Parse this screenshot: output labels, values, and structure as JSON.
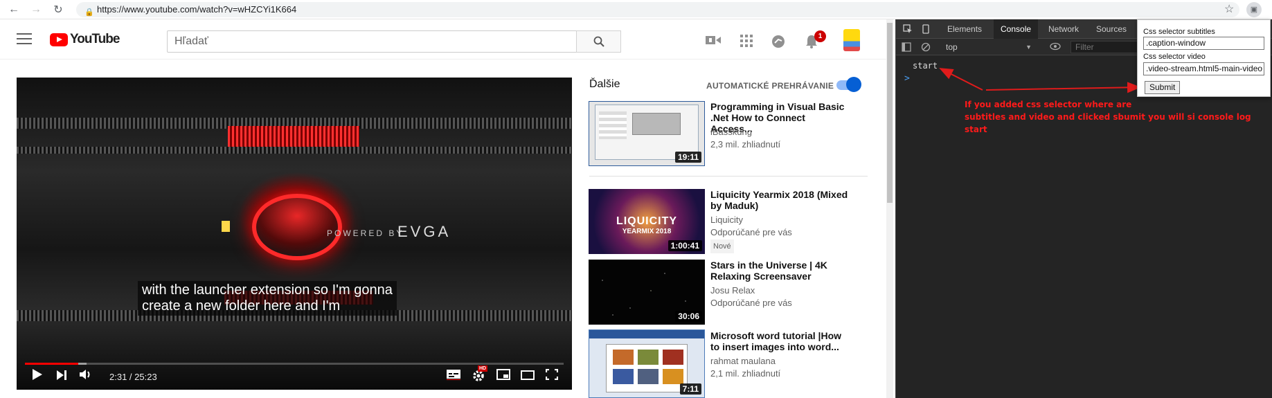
{
  "browser": {
    "url": "https://www.youtube.com/watch?v=wHZCYi1K664",
    "icons": [
      "back-icon",
      "forward-icon",
      "reload-icon",
      "lock-icon",
      "star-icon",
      "extension-icon"
    ]
  },
  "youtube": {
    "logo_text": "YouTube",
    "search_placeholder": "Hľadať",
    "notification_count": "1",
    "player": {
      "subtitle_line1": "with the launcher extension so I'm gonna",
      "subtitle_line2": "create a new folder here and I'm",
      "time": "2:31 / 25:23",
      "progress_played": 0.099,
      "progress_loaded": 0.115,
      "overlay_text": "POWERED BY",
      "overlay_brand": "EVGA",
      "hd_badge": "HD"
    },
    "sidebar": {
      "up_next": "Ďalšie",
      "autoplay_label": "AUTOMATICKÉ PREHRÁVANIE",
      "autoplay_on": true,
      "videos": [
        {
          "title": "Programming in Visual Basic .Net How to Connect Access...",
          "channel": "iBasskung",
          "meta": "2,3 mil. zhliadnutí",
          "duration": "19:11",
          "badge": ""
        },
        {
          "title": "Liquicity Yearmix 2018 (Mixed by Maduk)",
          "channel": "Liquicity",
          "meta": "Odporúčané pre vás",
          "duration": "1:00:41",
          "badge": "Nové"
        },
        {
          "title": "Stars in the Universe | 4K Relaxing Screensaver",
          "channel": "Josu Relax",
          "meta": "Odporúčané pre vás",
          "duration": "30:06",
          "badge": ""
        },
        {
          "title": "Microsoft word tutorial |How to insert images into word...",
          "channel": "rahmat maulana",
          "meta": "2,1 mil. zhliadnutí",
          "duration": "7:11",
          "badge": ""
        }
      ],
      "thumb_texts": {
        "liquicity": "LIQUICITY",
        "yearmix": "YEARMIX 2018"
      }
    }
  },
  "devtools": {
    "tabs": [
      "Elements",
      "Console",
      "Network",
      "Sources"
    ],
    "active_tab": "Console",
    "context": "top",
    "filter_placeholder": "Filter",
    "log_line": "start",
    "prompt": ">",
    "annotation_line1": "If you added css selector where are",
    "annotation_line2": "subtitles and video and clicked sbumit you will si console log start"
  },
  "popup": {
    "subtitles_label": "Css selector subtitles",
    "subtitles_value": ".caption-window",
    "video_label": "Css selector video",
    "video_value": ".video-stream.html5-main-video",
    "submit_label": "Submit"
  },
  "colors": {
    "youtube_red": "#ff0000",
    "toggle_blue": "#065fd4",
    "annotation_red": "#ff1a1a"
  }
}
